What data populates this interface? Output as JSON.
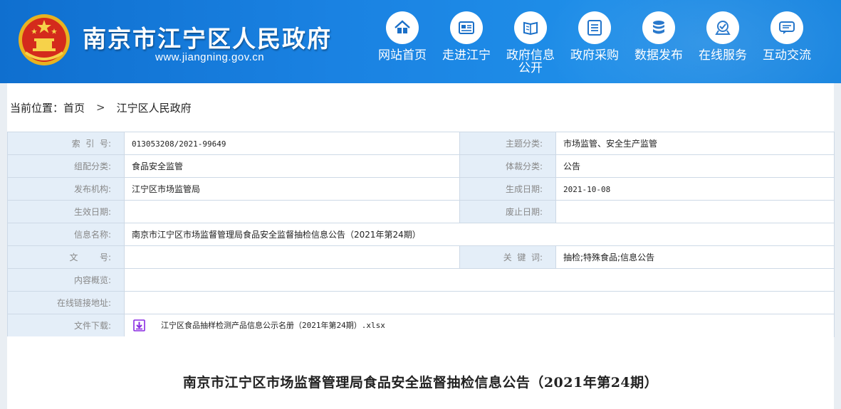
{
  "header": {
    "site_title": "南京市江宁区人民政府",
    "site_domain": "www.jiangning.gov.cn",
    "nav": [
      {
        "label": "网站首页",
        "icon": "home-icon"
      },
      {
        "label": "走进江宁",
        "icon": "newspaper-icon"
      },
      {
        "label": "政府信息公开",
        "icon": "book-icon"
      },
      {
        "label": "政府采购",
        "icon": "list-icon"
      },
      {
        "label": "数据发布",
        "icon": "database-icon"
      },
      {
        "label": "在线服务",
        "icon": "service-icon"
      },
      {
        "label": "互动交流",
        "icon": "chat-icon"
      }
    ]
  },
  "breadcrumb": {
    "prefix": "当前位置：",
    "items": [
      "首页",
      "江宁区人民政府"
    ],
    "separator": ">"
  },
  "meta": {
    "index_label": "索  引  号:",
    "index_value": "013053208/2021-99649",
    "topic_label": "主题分类:",
    "topic_value": "市场监管、安全生产监管",
    "group_label": "组配分类:",
    "group_value": "食品安全监管",
    "genre_label": "体裁分类:",
    "genre_value": "公告",
    "publisher_label": "发布机构:",
    "publisher_value": "江宁区市场监管局",
    "created_label": "生成日期:",
    "created_value": "2021-10-08",
    "effective_label": "生效日期:",
    "effective_value": "",
    "expire_label": "废止日期:",
    "expire_value": "",
    "name_label": "信息名称:",
    "name_value": "南京市江宁区市场监督管理局食品安全监督抽检信息公告（2021年第24期）",
    "docno_label": "文        号:",
    "docno_value": "",
    "keywords_label": "关  键  词:",
    "keywords_value": "抽检;特殊食品;信息公告",
    "overview_label": "内容概览:",
    "overview_value": "",
    "link_label": "在线链接地址:",
    "link_value": "",
    "download_label": "文件下载:",
    "download_value": "江宁区食品抽样检测产品信息公示名册（2021年第24期）.xlsx"
  },
  "article": {
    "title": "南京市江宁区市场监督管理局食品安全监督抽检信息公告（2021年第24期）"
  },
  "colors": {
    "header_blue": "#1a82e2",
    "label_bg": "#e4eef8",
    "download_icon": "#8a2be2"
  }
}
